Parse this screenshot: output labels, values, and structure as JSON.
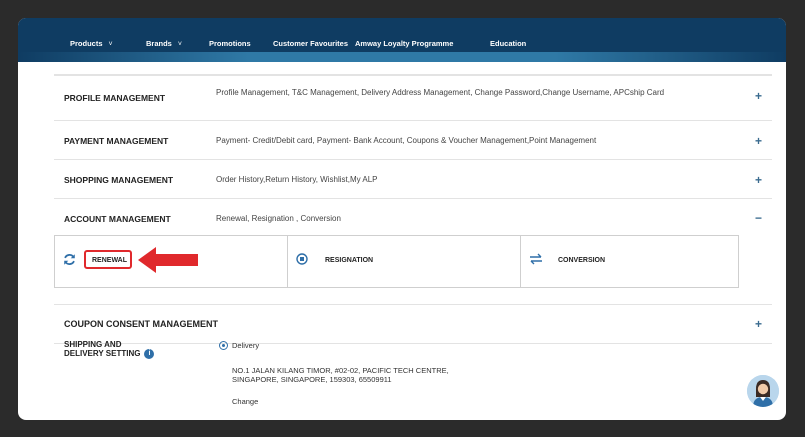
{
  "nav": {
    "items": [
      {
        "label": "Products",
        "chevron": "˅"
      },
      {
        "label": "Brands",
        "chevron": "˅"
      },
      {
        "label": "Promotions"
      },
      {
        "label": "Customer Favourites"
      },
      {
        "label": "Amway Loyalty Programme"
      },
      {
        "label": "Education"
      }
    ]
  },
  "sections": [
    {
      "title": "PROFILE MANAGEMENT",
      "desc": "Profile Management, T&C Management, Delivery Address Management, Change Password,Change Username, APCship Card",
      "toggle": "+"
    },
    {
      "title": "PAYMENT MANAGEMENT",
      "desc": "Payment- Credit/Debit card, Payment- Bank Account, Coupons & Voucher Management,Point Management",
      "toggle": "+"
    },
    {
      "title": "SHOPPING MANAGEMENT",
      "desc": "Order History,Return History, Wishlist,My ALP",
      "toggle": "+"
    },
    {
      "title": "ACCOUNT MANAGEMENT",
      "desc": "Renewal, Resignation , Conversion",
      "toggle": "−"
    }
  ],
  "account_cards": {
    "renewal": "RENEWAL",
    "resignation": "RESIGNATION",
    "conversion": "CONVERSION"
  },
  "coupon": {
    "title": "COUPON CONSENT MANAGEMENT",
    "toggle": "+"
  },
  "shipping": {
    "title_line1": "SHIPPING AND",
    "title_line2": "DELIVERY SETTING",
    "info_icon": "i",
    "option": "Delivery",
    "address": "NO.1 JALAN KILANG TIMOR, #02-02, PACIFIC TECH CENTRE, SINGAPORE, SINGAPORE, 159303, 65509911",
    "change": "Change"
  },
  "colors": {
    "nav": "#0f3c62",
    "accent": "#2f6fa8",
    "highlight": "#e0292c"
  }
}
